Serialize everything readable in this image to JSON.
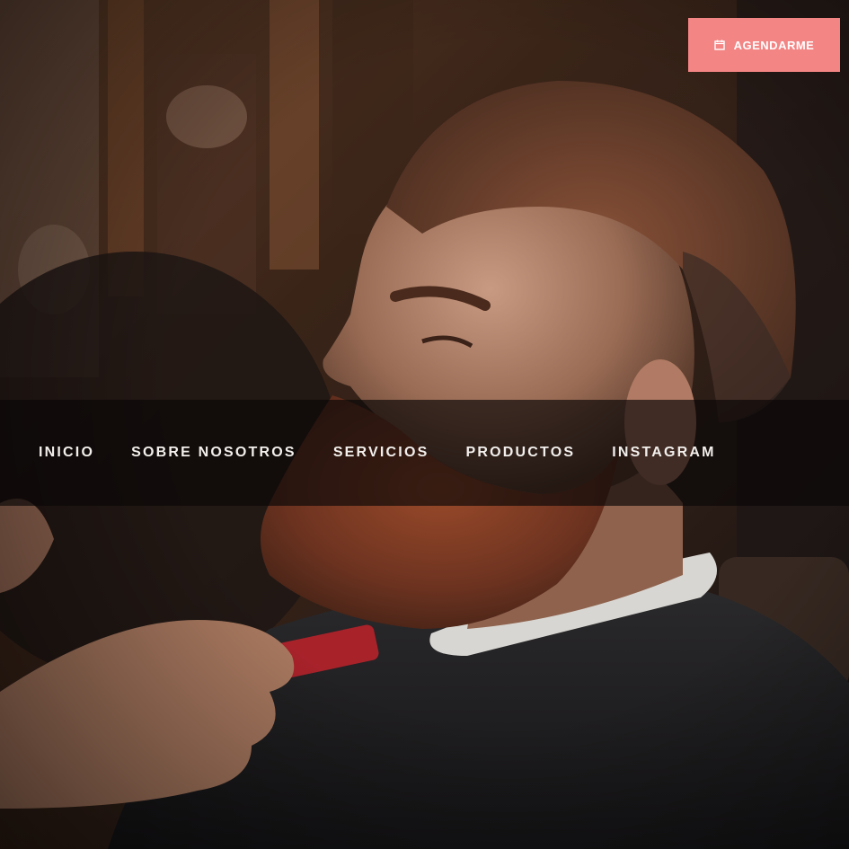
{
  "header": {
    "book_button": {
      "label": "AGENDARME",
      "icon": "calendar-icon",
      "color": "#f48585"
    }
  },
  "hero": {
    "image": "barber-trimming-beard-photo"
  },
  "nav": {
    "items": [
      {
        "label": "INICIO"
      },
      {
        "label": "SOBRE NOSOTROS"
      },
      {
        "label": "SERVICIOS"
      },
      {
        "label": "PRODUCTOS"
      },
      {
        "label": "INSTAGRAM"
      }
    ]
  }
}
